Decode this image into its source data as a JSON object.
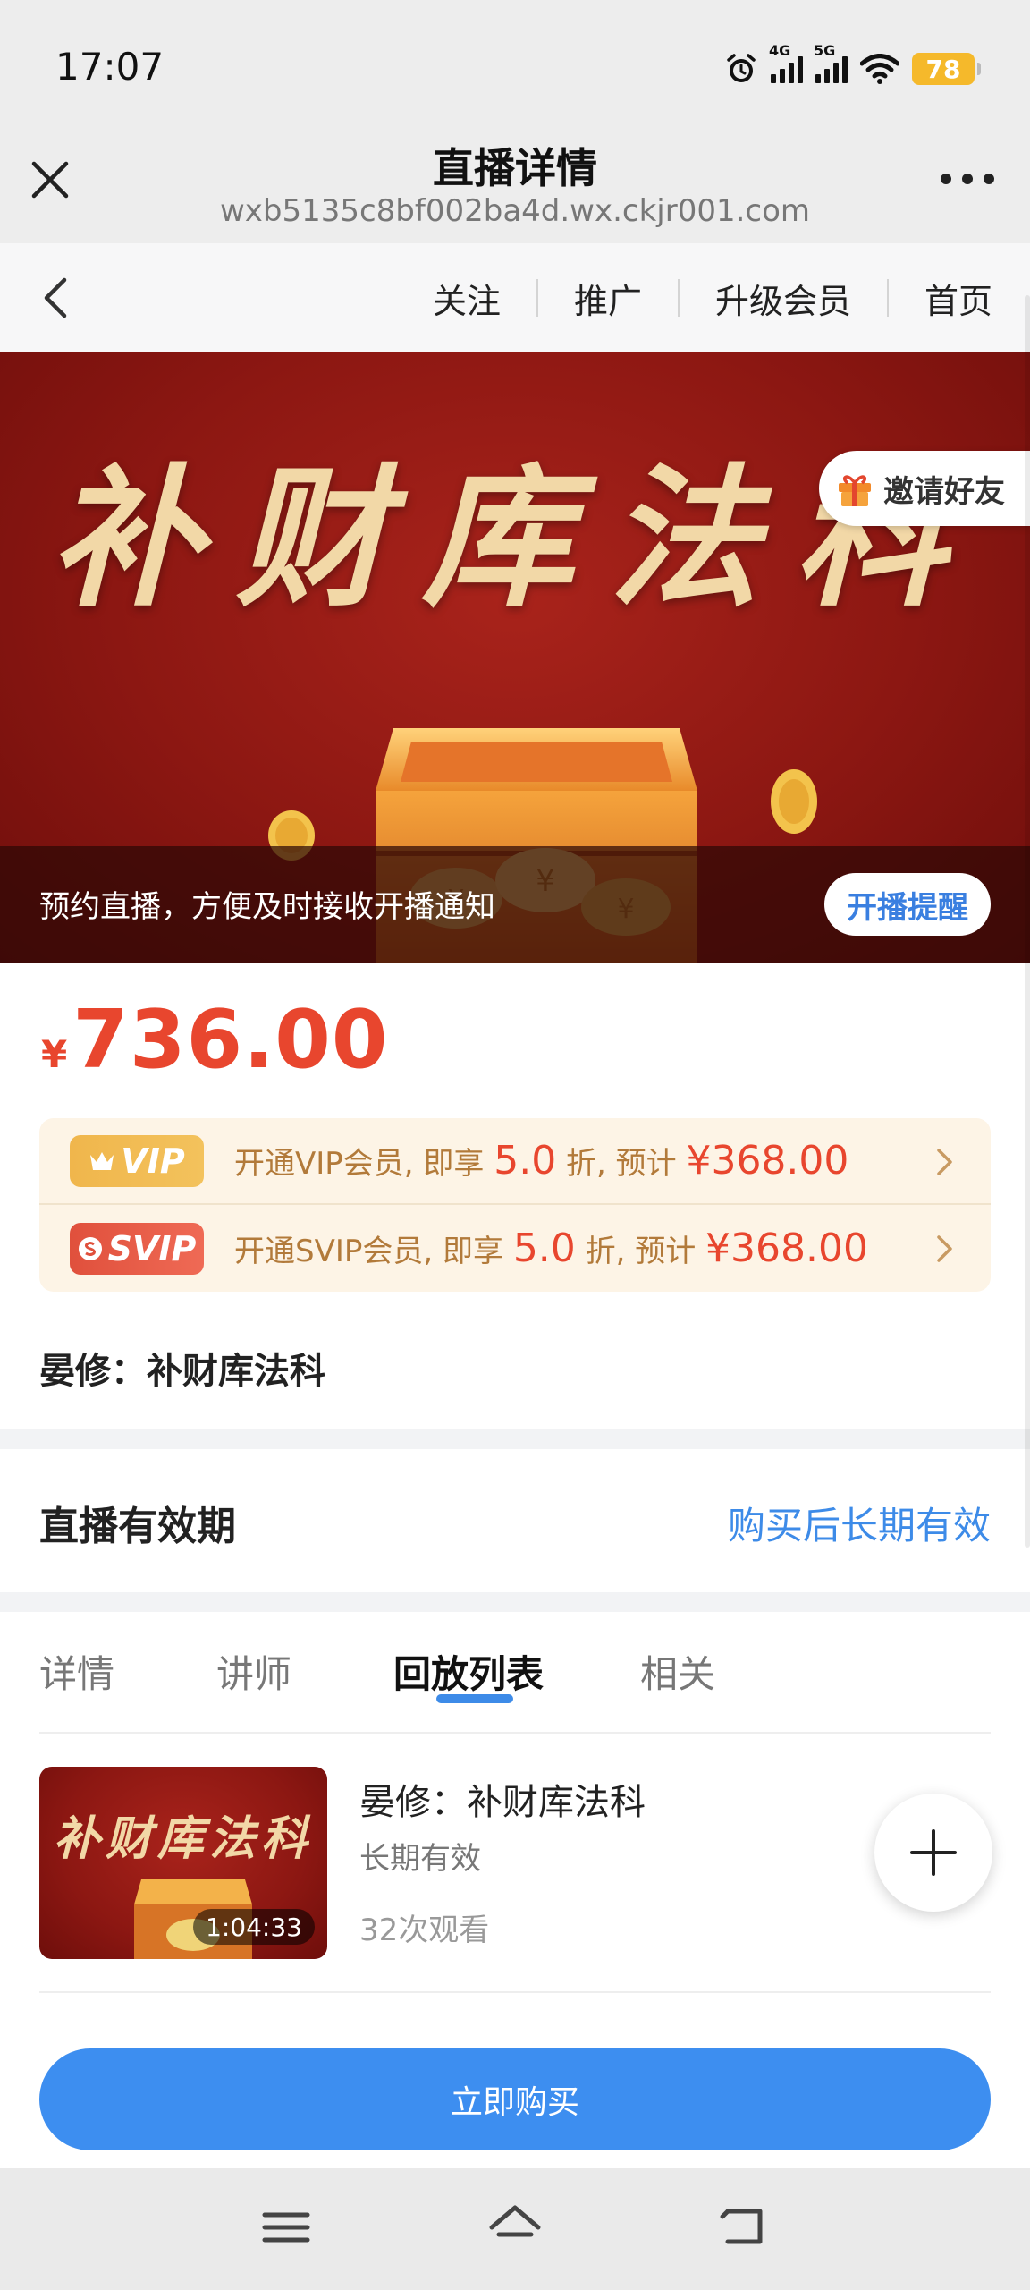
{
  "status_bar": {
    "time": "17:07",
    "signal1_label": "4G",
    "signal2_label": "5G",
    "battery": "78",
    "battery_color": "#f5b92b"
  },
  "title_bar": {
    "title": "直播详情",
    "url": "wxb5135c8bf002ba4d.wx.ckjr001.com",
    "close_icon": "close-icon",
    "more_icon": "more-dots-icon"
  },
  "nav": {
    "links": [
      "关注",
      "推广",
      "升级会员",
      "首页"
    ]
  },
  "banner": {
    "title": "补财库法科",
    "invite_label": "邀请好友",
    "notify_text": "预约直播，方便及时接收开播通知",
    "remind_label": "开播提醒"
  },
  "price": {
    "symbol": "¥",
    "value": "736.00",
    "color": "#e8462e"
  },
  "vip": {
    "rows": [
      {
        "badge": "VIP",
        "prefix": "开通VIP会员, 即享",
        "discount": "5.0",
        "mid": "折, 预计",
        "amount": "¥368.00"
      },
      {
        "badge": "SVIP",
        "prefix": "开通SVIP会员, 即享",
        "discount": "5.0",
        "mid": "折, 预计",
        "amount": "¥368.00"
      }
    ]
  },
  "course": {
    "title": "晏修：补财库法科"
  },
  "validity": {
    "label": "直播有效期",
    "value": "购买后长期有效"
  },
  "tabs": {
    "items": [
      "详情",
      "讲师",
      "回放列表",
      "相关"
    ],
    "active": "回放列表",
    "accent": "#3d8be8"
  },
  "playlist": {
    "items": [
      {
        "thumb_title": "补财库法科",
        "duration": "1:04:33",
        "title": "晏修：补财库法科",
        "validity": "长期有效",
        "views": "32次观看"
      }
    ]
  },
  "buy": {
    "label": "立即购买",
    "color": "#3d8ef0"
  },
  "system_nav": {
    "icons": [
      "menu-icon",
      "home-icon",
      "back-icon"
    ]
  }
}
